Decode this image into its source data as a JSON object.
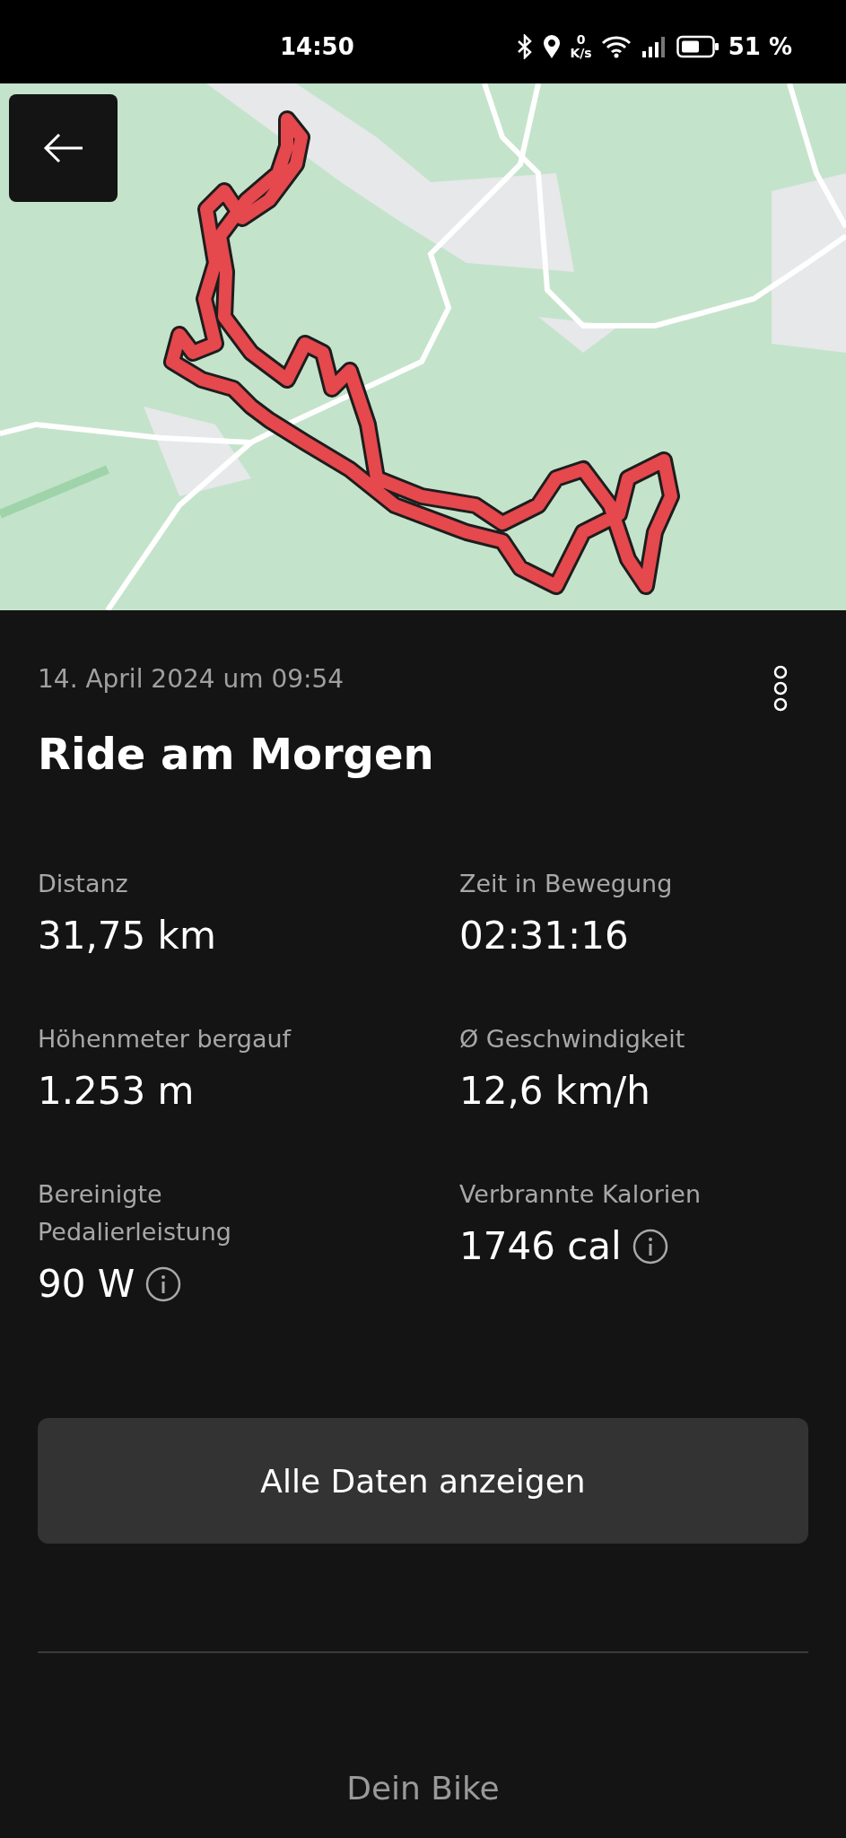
{
  "status_bar": {
    "time": "14:50",
    "net_speed_value": "0",
    "net_speed_unit": "K/s",
    "battery": "51 %"
  },
  "activity": {
    "date": "14. April 2024 um 09:54",
    "title": "Ride am Morgen"
  },
  "stats": [
    {
      "label": "Distanz",
      "value": "31,75 km",
      "info": false
    },
    {
      "label": "Zeit in Bewegung",
      "value": "02:31:16",
      "info": false
    },
    {
      "label": "Höhenmeter bergauf",
      "value": "1.253 m",
      "info": false
    },
    {
      "label": "Ø Geschwindigkeit",
      "value": "12,6 km/h",
      "info": false
    },
    {
      "label": "Bereinigte Pedalierleistung",
      "value": "90 W",
      "info": true
    },
    {
      "label": "Verbrannte Kalorien",
      "value": "1746 cal",
      "info": true
    }
  ],
  "button": {
    "label": "Alle Daten anzeigen"
  },
  "bike": {
    "heading": "Dein Bike"
  }
}
